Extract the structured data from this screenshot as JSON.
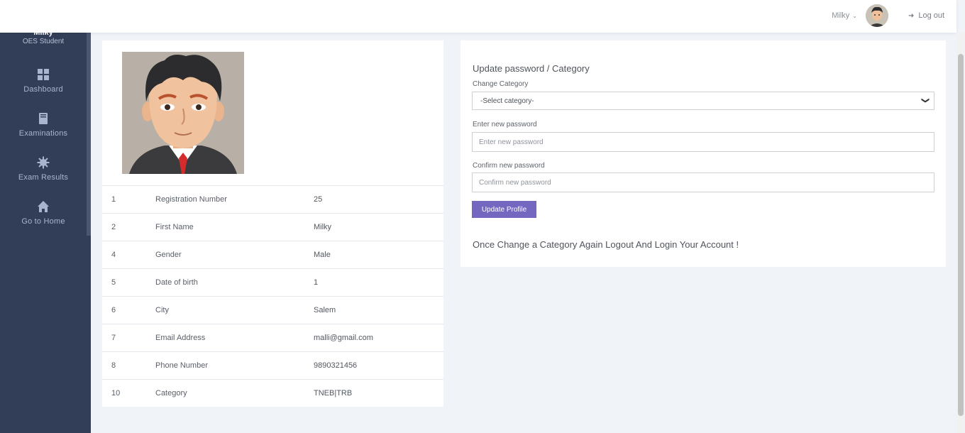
{
  "sidebar": {
    "user_name": "Milky",
    "user_role": "OES Student",
    "items": [
      {
        "label": "Dashboard",
        "icon": "grid-icon"
      },
      {
        "label": "Examinations",
        "icon": "book-icon"
      },
      {
        "label": "Exam Results",
        "icon": "gear-icon"
      },
      {
        "label": "Go to Home",
        "icon": "home-icon"
      }
    ]
  },
  "topbar": {
    "user_name": "Milky",
    "logout_label": "Log out"
  },
  "profile": {
    "rows": [
      {
        "num": "1",
        "field": "Registration Number",
        "value": "25"
      },
      {
        "num": "2",
        "field": "First Name",
        "value": "Milky"
      },
      {
        "num": "4",
        "field": "Gender",
        "value": "Male"
      },
      {
        "num": "5",
        "field": "Date of birth",
        "value": "1"
      },
      {
        "num": "6",
        "field": "City",
        "value": "Salem"
      },
      {
        "num": "7",
        "field": "Email Address",
        "value": "malli@gmail.com"
      },
      {
        "num": "8",
        "field": "Phone Number",
        "value": "9890321456"
      },
      {
        "num": "10",
        "field": "Category",
        "value": "TNEB|TRB"
      }
    ]
  },
  "form": {
    "title": "Update password / Category",
    "category_label": "Change Category",
    "category_selected": "-Select category-",
    "new_password_label": "Enter new password",
    "new_password_placeholder": "Enter new password",
    "confirm_password_label": "Confirm new password",
    "confirm_password_placeholder": "Confirm new password",
    "submit_label": "Update Profile",
    "notice": "Once Change a Category Again Logout And Login Your Account !"
  },
  "colors": {
    "sidebar_bg": "#323e57",
    "button_bg": "#7467c0",
    "page_bg": "#f0f3f7"
  }
}
